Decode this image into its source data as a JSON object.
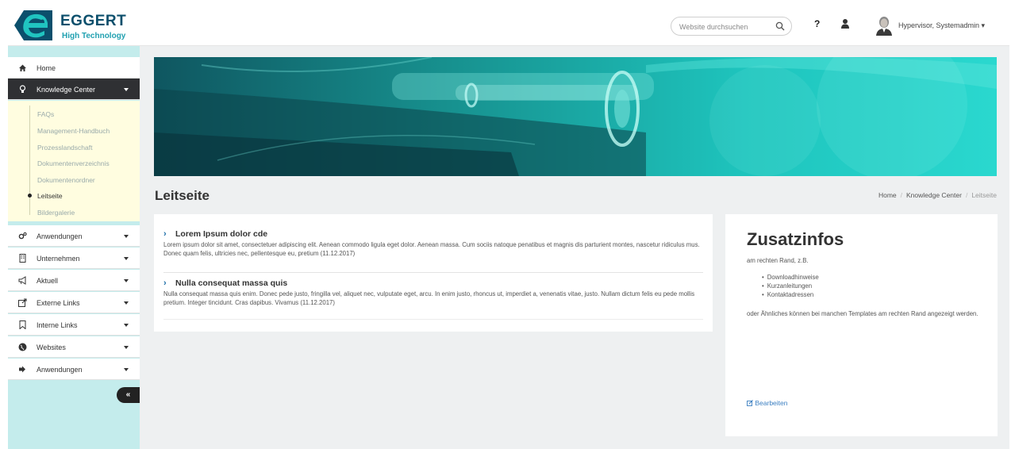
{
  "header": {
    "logo_name": "EGGERT",
    "logo_tagline": "High Technology",
    "search_placeholder": "Website durchsuchen",
    "help_label": "?",
    "user_name": "Hypervisor, Systemadmin ▾"
  },
  "sidebar": {
    "home": "Home",
    "knowledge_center": "Knowledge Center",
    "submenu": [
      "FAQs",
      "Management-Handbuch",
      "Prozesslandschaft",
      "Dokumentenverzeichnis",
      "Dokumentenordner",
      "Leitseite",
      "Bildergalerie"
    ],
    "items": [
      {
        "label": "Anwendungen",
        "icon": "cogs-icon"
      },
      {
        "label": "Unternehmen",
        "icon": "building-icon"
      },
      {
        "label": "Aktuell",
        "icon": "bullhorn-icon"
      },
      {
        "label": "Externe Links",
        "icon": "external-link-icon"
      },
      {
        "label": "Interne Links",
        "icon": "bookmark-icon"
      },
      {
        "label": "Websites",
        "icon": "globe-icon"
      },
      {
        "label": "Anwendungen",
        "icon": "sign-in-icon"
      }
    ],
    "collapse_label": "«"
  },
  "page": {
    "title": "Leitseite",
    "breadcrumb": [
      "Home",
      "Knowledge Center",
      "Leitseite"
    ]
  },
  "articles": [
    {
      "title": "Lorem Ipsum dolor cde",
      "text": "Lorem ipsum dolor sit amet, consectetuer adipiscing elit. Aenean commodo ligula eget dolor. Aenean massa. Cum sociis natoque penatibus et magnis dis parturient montes, nascetur ridiculus mus. Donec quam felis, ultricies nec, pellentesque eu, pretium (11.12.2017)"
    },
    {
      "title": "Nulla consequat massa quis",
      "text": "Nulla consequat massa quis enim. Donec pede justo, fringilla vel, aliquet nec, vulputate eget, arcu. In enim justo, rhoncus ut, imperdiet a, venenatis vitae, justo. Nullam dictum felis eu pede mollis pretium. Integer tincidunt. Cras dapibus. Vivamus (11.12.2017)"
    }
  ],
  "info": {
    "title": "Zusatzinfos",
    "subtitle": "am rechten Rand, z.B.",
    "list": [
      "Downloadhinweise",
      "Kurzanleitungen",
      "Kontaktadressen"
    ],
    "text": "oder Ähnliches können bei manchen Templates am rechten Rand angezeigt werden.",
    "edit_label": "Bearbeiten"
  },
  "colors": {
    "accent": "#20c4c0",
    "sidebar_bg": "#c4ecec",
    "submenu_bg": "#fffde0",
    "active_bg": "#2f3033",
    "link": "#3b7fc1"
  }
}
